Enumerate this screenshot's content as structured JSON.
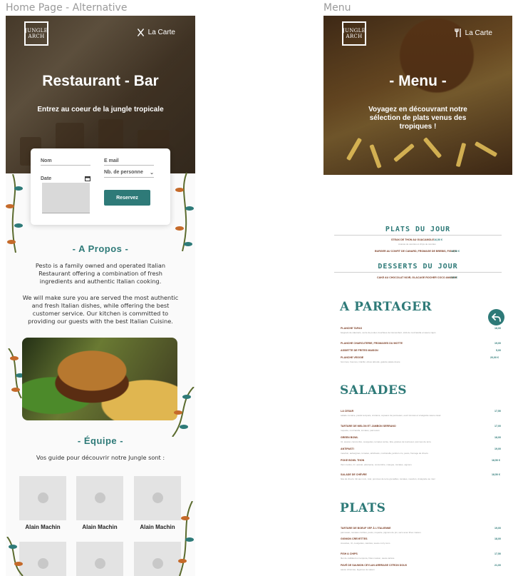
{
  "frames": {
    "left_label": "Home Page - Alternative",
    "right_label": "Menu"
  },
  "logo": {
    "line1": "JUNGLE",
    "line2": "ARCH"
  },
  "home": {
    "nav_label": "La Carte",
    "title": "Restaurant - Bar",
    "subtitle": "Entrez au coeur de la jungle tropicale",
    "booking": {
      "name_placeholder": "Nom",
      "email_placeholder": "E mail",
      "date_label": "Date",
      "guests_label": "Nb. de personne",
      "reserve_label": "Reservez"
    },
    "about": {
      "title": "- A Propos -",
      "para1": "Pesto is a family owned and operated Italian Restaurant offering a combination of fresh ingredients and authentic Italian cooking.",
      "para2": "We will make sure you are served the most authentic and fresh Italian dishes, while offering the best customer service. Our kitchen is committed to providing our guests with the best Italian Cuisine."
    },
    "team": {
      "title": "- Équipe -",
      "subtitle": "Vos guide pour découvrir notre Jungle sont :",
      "members": [
        "Alain Machin",
        "Alain Machin",
        "Alain Machin"
      ]
    }
  },
  "menu": {
    "nav_label": "La Carte",
    "title": "- Menu -",
    "subtitle": "Voyagez en découvrant notre sélection de plats venus des tropiques !",
    "plats_du_jour": {
      "heading": "PLATS DU JOUR",
      "items": [
        {
          "name": "STEAK DE THON AU GUACAMOLE",
          "price": "16,50 €",
          "desc": "Ananas de carottes et chips de carottes"
        },
        {
          "name": "BURGER AU CONFIT DE CANARD, FROMAGE DE BREBIS, FIGUES",
          "price": "16,50 €"
        }
      ]
    },
    "desserts_du_jour": {
      "heading": "DESSERTS DU JOUR",
      "items": [
        {
          "name": "CAKE AU CHOCOLAT NOIR, GLACAGE ROCHER COCO AMANDE",
          "price": "7,50 €"
        }
      ]
    },
    "a_partager": {
      "heading": "A PARTAGER",
      "items": [
        {
          "name": "PLANCHE TAPAS",
          "price": "18,00",
          "desc": "beignets de calamars, vente de poulet, bouchées de Camembert, stick de mozzarella et sauce cajun"
        },
        {
          "name": "PLANCHE CHARCUTERIE, FROMAGES DU MOTTE",
          "price": "19,00"
        },
        {
          "name": "ASSIETTE DE FRITES MAISON",
          "price": "5,00"
        },
        {
          "name": "PLANCHE VEGGIE",
          "price": "20,00 €",
          "desc": "hommos, houmos, tzatziki, olives taboulé, galette patate douce"
        }
      ]
    },
    "salades": {
      "heading": "SALADES",
      "items": [
        {
          "name": "LA CESAR",
          "price": "17,50",
          "desc": "salade romaine, poulet tempura, croûtons, copeaux de parmesan, oeuf mimosé et vinaigrette sauce césar"
        },
        {
          "name": "TARTARE DE MELON ET JAMBON SERRANO",
          "price": "17,00",
          "desc": "roquette, mozzarella, tomates, parmesan"
        },
        {
          "name": "GREEN BOWL",
          "price": "18,00",
          "desc": "riz, avocat, concombre, courgettes, tomates cerise, fèta, graines de tournesol, pommes de terre"
        },
        {
          "name": "ANTIPASTI",
          "price": "19,00",
          "desc": "mesclun, aubergines, tomates, artichauts, mozzarella, jambon cru, pesto, fromage de chèvre"
        },
        {
          "name": "POKE BOWL THON",
          "price": "18,50 €",
          "desc": "thon mariné, riz, avocat, edamame, concombre, mangue, tomates, oignons"
        },
        {
          "name": "SALADE DE CHÈVRE",
          "price": "18,50 €",
          "desc": "fèta de chevre rôti aux noix, miel, pommes de terre grenailles, tomates, mesclun, vinaigrette au miel"
        }
      ]
    },
    "plats": {
      "heading": "PLATS",
      "items": [
        {
          "name": "TARTARE DE BOEUF VEF À L'ITALIENNE",
          "price": "19,00",
          "desc": "parmesan, tomates confites, pesto, roquette, pignons de pin, servi avec frites maison"
        },
        {
          "name": "GIGMON CREVETTES",
          "price": "18,00",
          "desc": "crevettes, riz, courgettes, carottes, sauce curry coco"
        },
        {
          "name": "FISH & CHIPS",
          "price": "17,50",
          "desc": "filet de cabillaud en tempura, frites maison, sauce tartare"
        },
        {
          "name": "PAVÉ DE SAUMON CEYLAN ARRRAGE CITRON DOUX",
          "price": "21,00",
          "desc": "sauce citronnée, légumes de saison"
        }
      ]
    }
  },
  "colors": {
    "accent": "#2e7a78",
    "menu_item": "#7a3b22"
  }
}
